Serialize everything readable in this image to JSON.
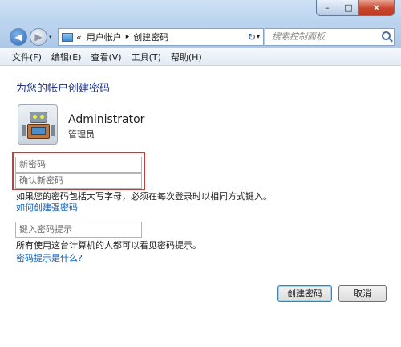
{
  "window": {
    "controls": {
      "minimize": "–",
      "maximize": "□",
      "close": "✕"
    }
  },
  "address_bar": {
    "back_icon": "arrow-left-icon",
    "forward_icon": "arrow-right-icon",
    "breadcrumb_prefix": "«",
    "breadcrumb": [
      "用户帐户",
      "创建密码"
    ],
    "breadcrumb_separator": "▸",
    "dropdown_glyph": "▾",
    "refresh_glyph": "↻",
    "search_placeholder": "搜索控制面板"
  },
  "menu": {
    "items": [
      "文件(F)",
      "编辑(E)",
      "查看(V)",
      "工具(T)",
      "帮助(H)"
    ]
  },
  "main": {
    "title": "为您的帐户创建密码",
    "user": {
      "name": "Administrator",
      "role": "管理员"
    },
    "new_password_placeholder": "新密码",
    "confirm_password_placeholder": "确认新密码",
    "case_note": "如果您的密码包括大写字母，必须在每次登录时以相同方式键入。",
    "strong_password_link": "如何创建强密码",
    "hint_placeholder": "键入密码提示",
    "hint_note": "所有使用这台计算机的人都可以看见密码提示。",
    "hint_help_link": "密码提示是什么?",
    "create_button": "创建密码",
    "cancel_button": "取消"
  },
  "colors": {
    "title": "#1e3287",
    "link": "#0a63c9",
    "highlight_border": "#c43c3c"
  }
}
